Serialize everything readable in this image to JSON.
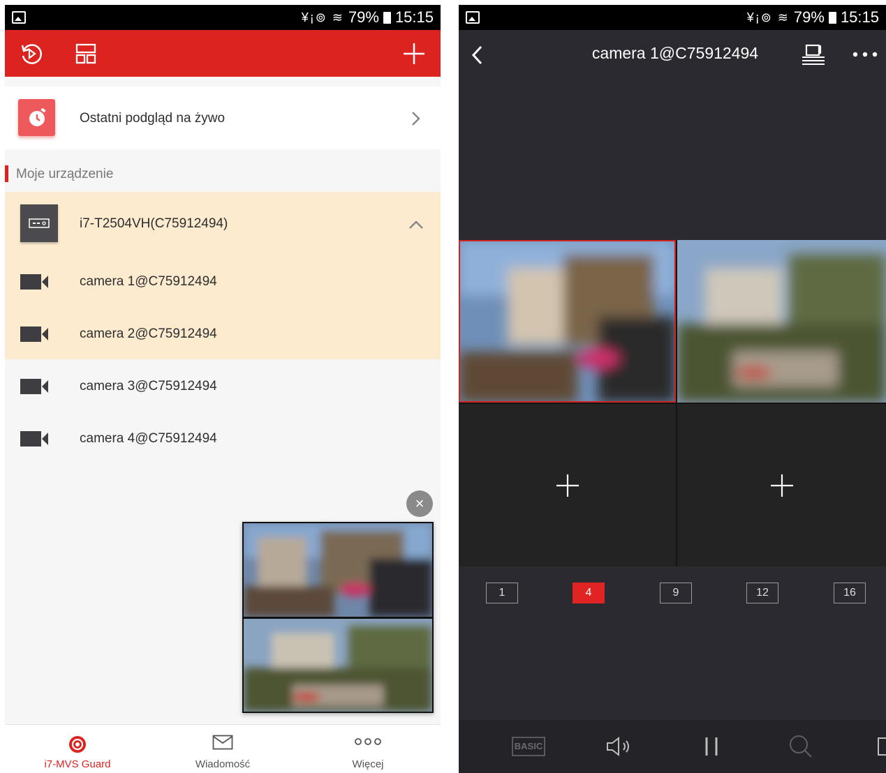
{
  "status_bar": {
    "battery": "79%",
    "time": "15:15",
    "icons": "¥¡⊚ ≋"
  },
  "left": {
    "recent_live_label": "Ostatni podgląd na żywo",
    "section_title": "Moje urządzenie",
    "device": {
      "name": "i7-T2504VH(C75912494)"
    },
    "cameras": [
      {
        "name": "camera 1@C75912494"
      },
      {
        "name": "camera 2@C75912494"
      },
      {
        "name": "camera 3@C75912494"
      },
      {
        "name": "camera 4@C75912494"
      }
    ],
    "close_symbol": "×",
    "nav": [
      {
        "label": "i7-MVS Guard",
        "icon": "guard-icon"
      },
      {
        "label": "Wiadomość",
        "icon": "message-icon"
      },
      {
        "label": "Więcej",
        "icon": "more-icon"
      }
    ],
    "accent_color": "#dd2320"
  },
  "right": {
    "title": "camera 1@C75912494",
    "split_options": [
      "1",
      "4",
      "9",
      "12",
      "16"
    ],
    "active_split": "4",
    "toolbar": {
      "basic_label": "BASIC"
    },
    "accent_color": "#e02423"
  }
}
